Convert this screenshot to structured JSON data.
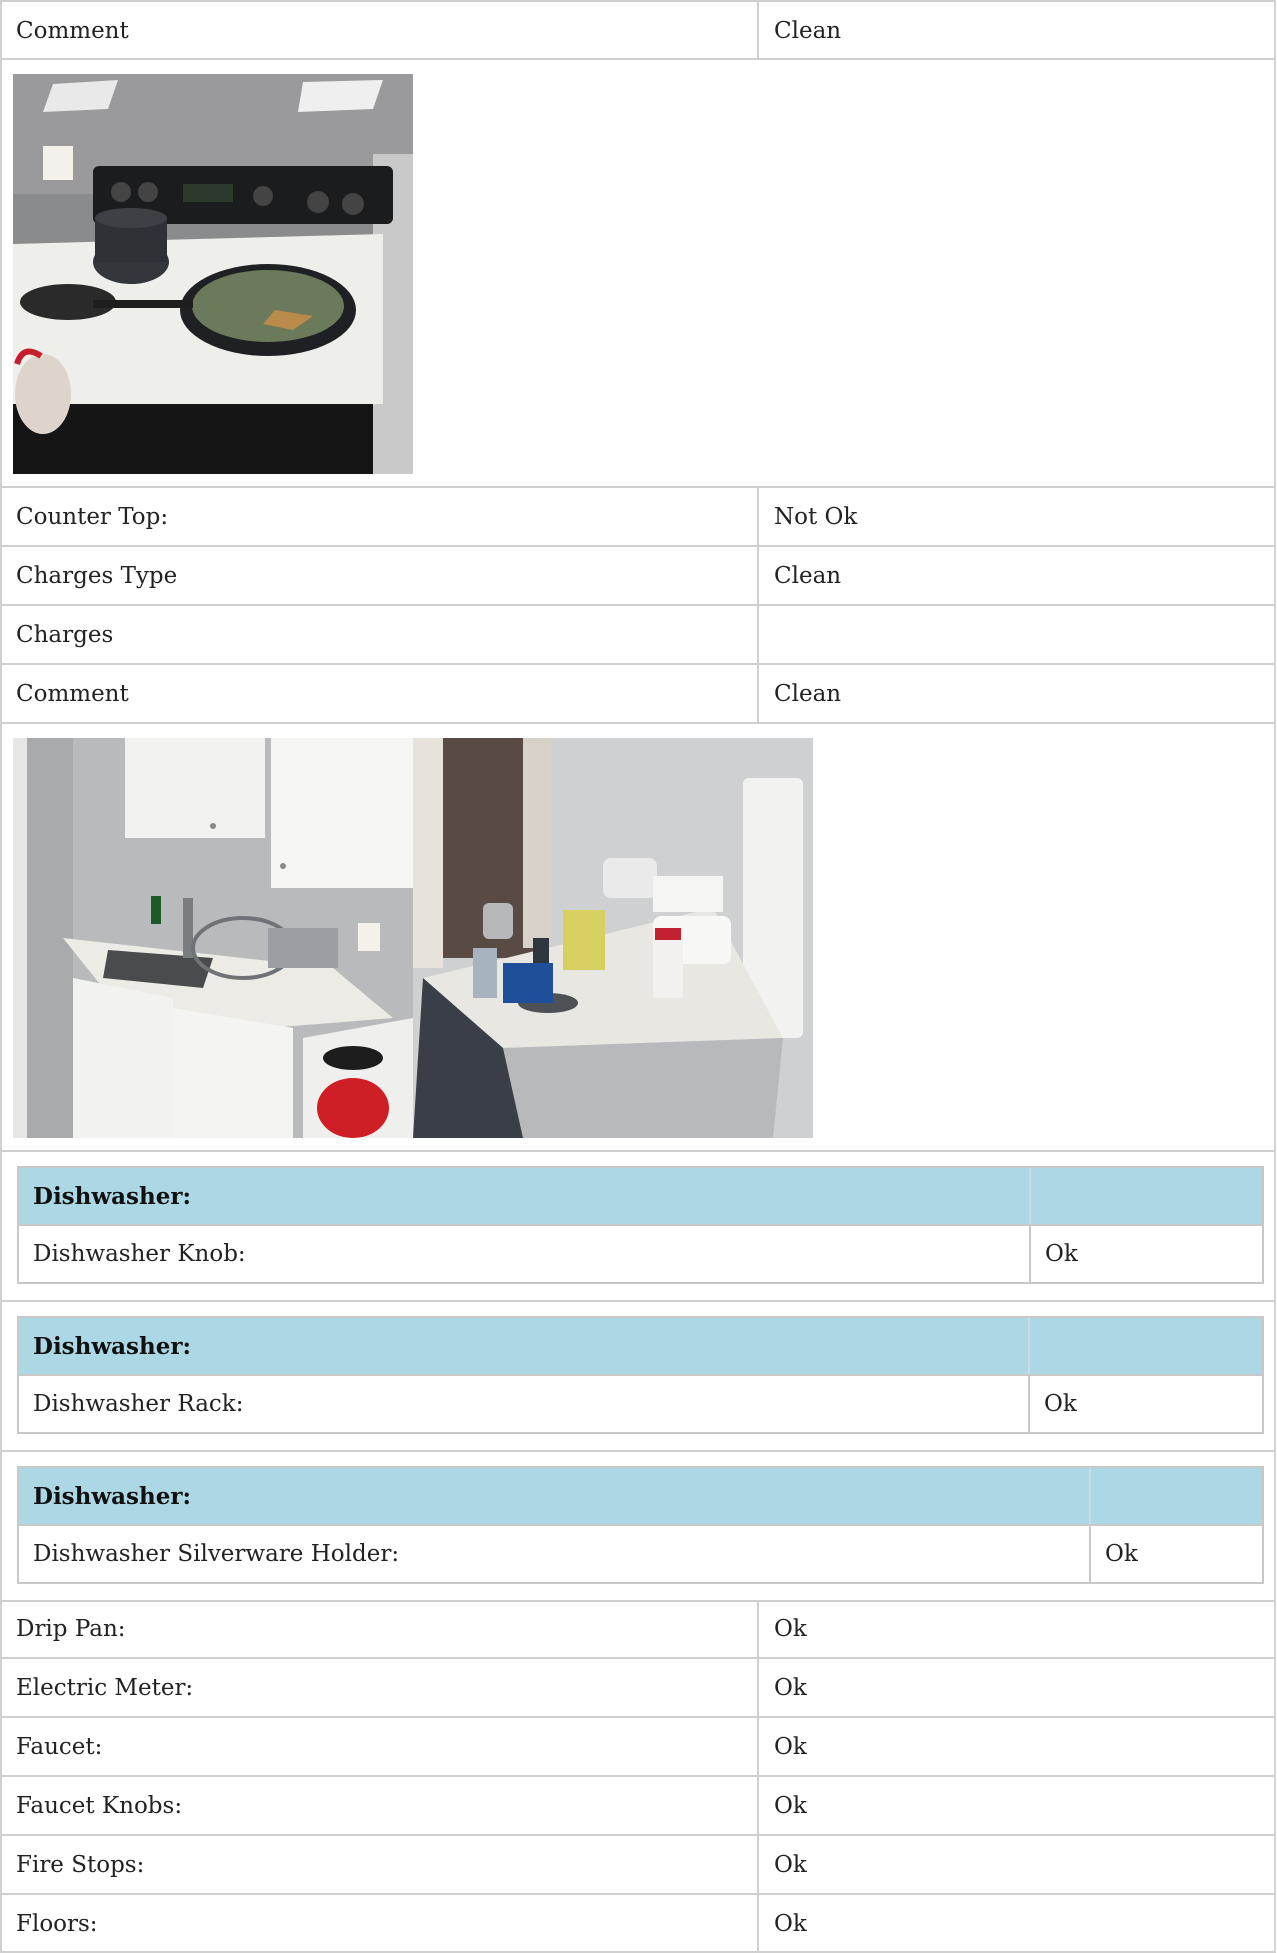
{
  "rows_top": [
    {
      "label": "Comment",
      "value": "Clean"
    }
  ],
  "counter": [
    {
      "label": "Counter Top:",
      "value": "Not Ok"
    },
    {
      "label": "Charges Type",
      "value": "Clean"
    },
    {
      "label": "Charges",
      "value": ""
    },
    {
      "label": "Comment",
      "value": "Clean"
    }
  ],
  "dishwasher": [
    {
      "heading": "Dishwasher:",
      "label": "Dishwasher Knob:",
      "value": "Ok"
    },
    {
      "heading": "Dishwasher:",
      "label": "Dishwasher Rack:",
      "value": "Ok"
    },
    {
      "heading": "Dishwasher:",
      "label": "Dishwasher Silverware Holder:",
      "value": "Ok"
    }
  ],
  "rows_bottom": [
    {
      "label": "Drip Pan:",
      "value": "Ok"
    },
    {
      "label": "Electric Meter:",
      "value": "Ok"
    },
    {
      "label": "Faucet:",
      "value": "Ok"
    },
    {
      "label": "Faucet Knobs:",
      "value": "Ok"
    },
    {
      "label": "Fire Stops:",
      "value": "Ok"
    },
    {
      "label": "Floors:",
      "value": "Ok"
    }
  ]
}
